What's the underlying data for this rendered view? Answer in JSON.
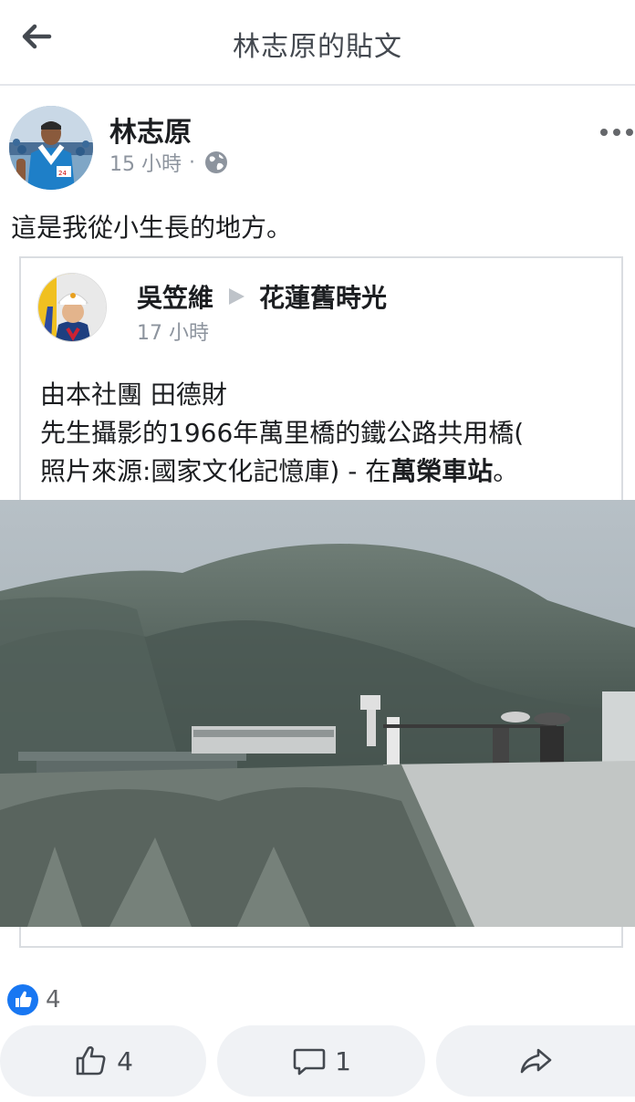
{
  "header": {
    "title": "林志原的貼文"
  },
  "post": {
    "author": "林志原",
    "time": "15 小時",
    "separator": "·",
    "text": "這是我從小生長的地方。"
  },
  "shared_post": {
    "author": "吳笠維",
    "group": "花蓮舊時光",
    "time": "17 小時",
    "text_line1": "由本社團 田德財",
    "text_line2": "先生攝影的1966年萬里橋的鐵公路共用橋(",
    "text_line3_prefix": "照片來源:國家文化記憶庫) - 在",
    "location": "萬榮車站",
    "text_line3_suffix": "。"
  },
  "reactions": {
    "like_count": "4"
  },
  "actions": {
    "like_count": "4",
    "comment_count": "1"
  },
  "colors": {
    "accent": "#1877f2",
    "muted": "#8d949e",
    "button_bg": "#f0f2f5"
  }
}
